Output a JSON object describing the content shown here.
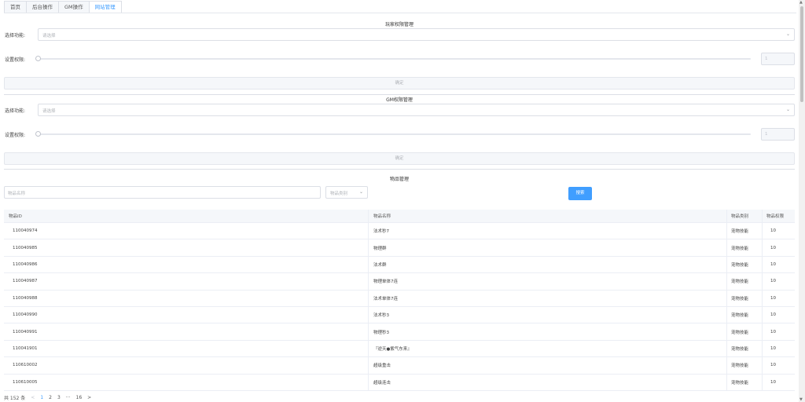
{
  "tabs": [
    {
      "label": "首页",
      "active": false
    },
    {
      "label": "后台操作",
      "active": false
    },
    {
      "label": "GM操作",
      "active": false
    },
    {
      "label": "网站管理",
      "active": true
    }
  ],
  "player_perm": {
    "title": "玩家权限管理",
    "select_label": "选择功能:",
    "select_placeholder": "请选择",
    "perm_label": "设置权限:",
    "perm_value": "1",
    "confirm_label": "确定"
  },
  "gm_perm": {
    "title": "GM权限管理",
    "select_label": "选择功能:",
    "select_placeholder": "请选择",
    "perm_label": "设置权限:",
    "perm_value": "1",
    "confirm_label": "确定"
  },
  "item_mgmt": {
    "title": "物品管理",
    "name_placeholder": "物品名称",
    "category_placeholder": "物品类别",
    "search_label": "搜索"
  },
  "table": {
    "headers": [
      "物品ID",
      "物品名称",
      "物品类别",
      "物品权限"
    ],
    "rows": [
      [
        "110040974",
        "法术秒7",
        "宠物技能",
        "10"
      ],
      [
        "110040985",
        "物理群",
        "宠物技能",
        "10"
      ],
      [
        "110040986",
        "法术群",
        "宠物技能",
        "10"
      ],
      [
        "110040987",
        "物理单体7连",
        "宠物技能",
        "10"
      ],
      [
        "110040988",
        "法术单体7连",
        "宠物技能",
        "10"
      ],
      [
        "110040990",
        "法术秒3",
        "宠物技能",
        "10"
      ],
      [
        "110040991",
        "物理秒3",
        "宠物技能",
        "10"
      ],
      [
        "110041901",
        "『逆天●紫气东来』",
        "宠物技能",
        "10"
      ],
      [
        "110610002",
        "超级重击",
        "宠物技能",
        "10"
      ],
      [
        "110610005",
        "超级连击",
        "宠物技能",
        "10"
      ]
    ]
  },
  "pager": {
    "total": "共 152 条",
    "prev": "<",
    "pages": [
      "1",
      "2",
      "3",
      "···",
      "16"
    ],
    "active_page": "1",
    "next": ">"
  },
  "colors": {
    "accent": "#409eff"
  },
  "icons": {
    "select_chevron": "chevron-down-icon",
    "scroll_up": "scroll-up-icon",
    "scroll_down": "scroll-down-icon"
  }
}
